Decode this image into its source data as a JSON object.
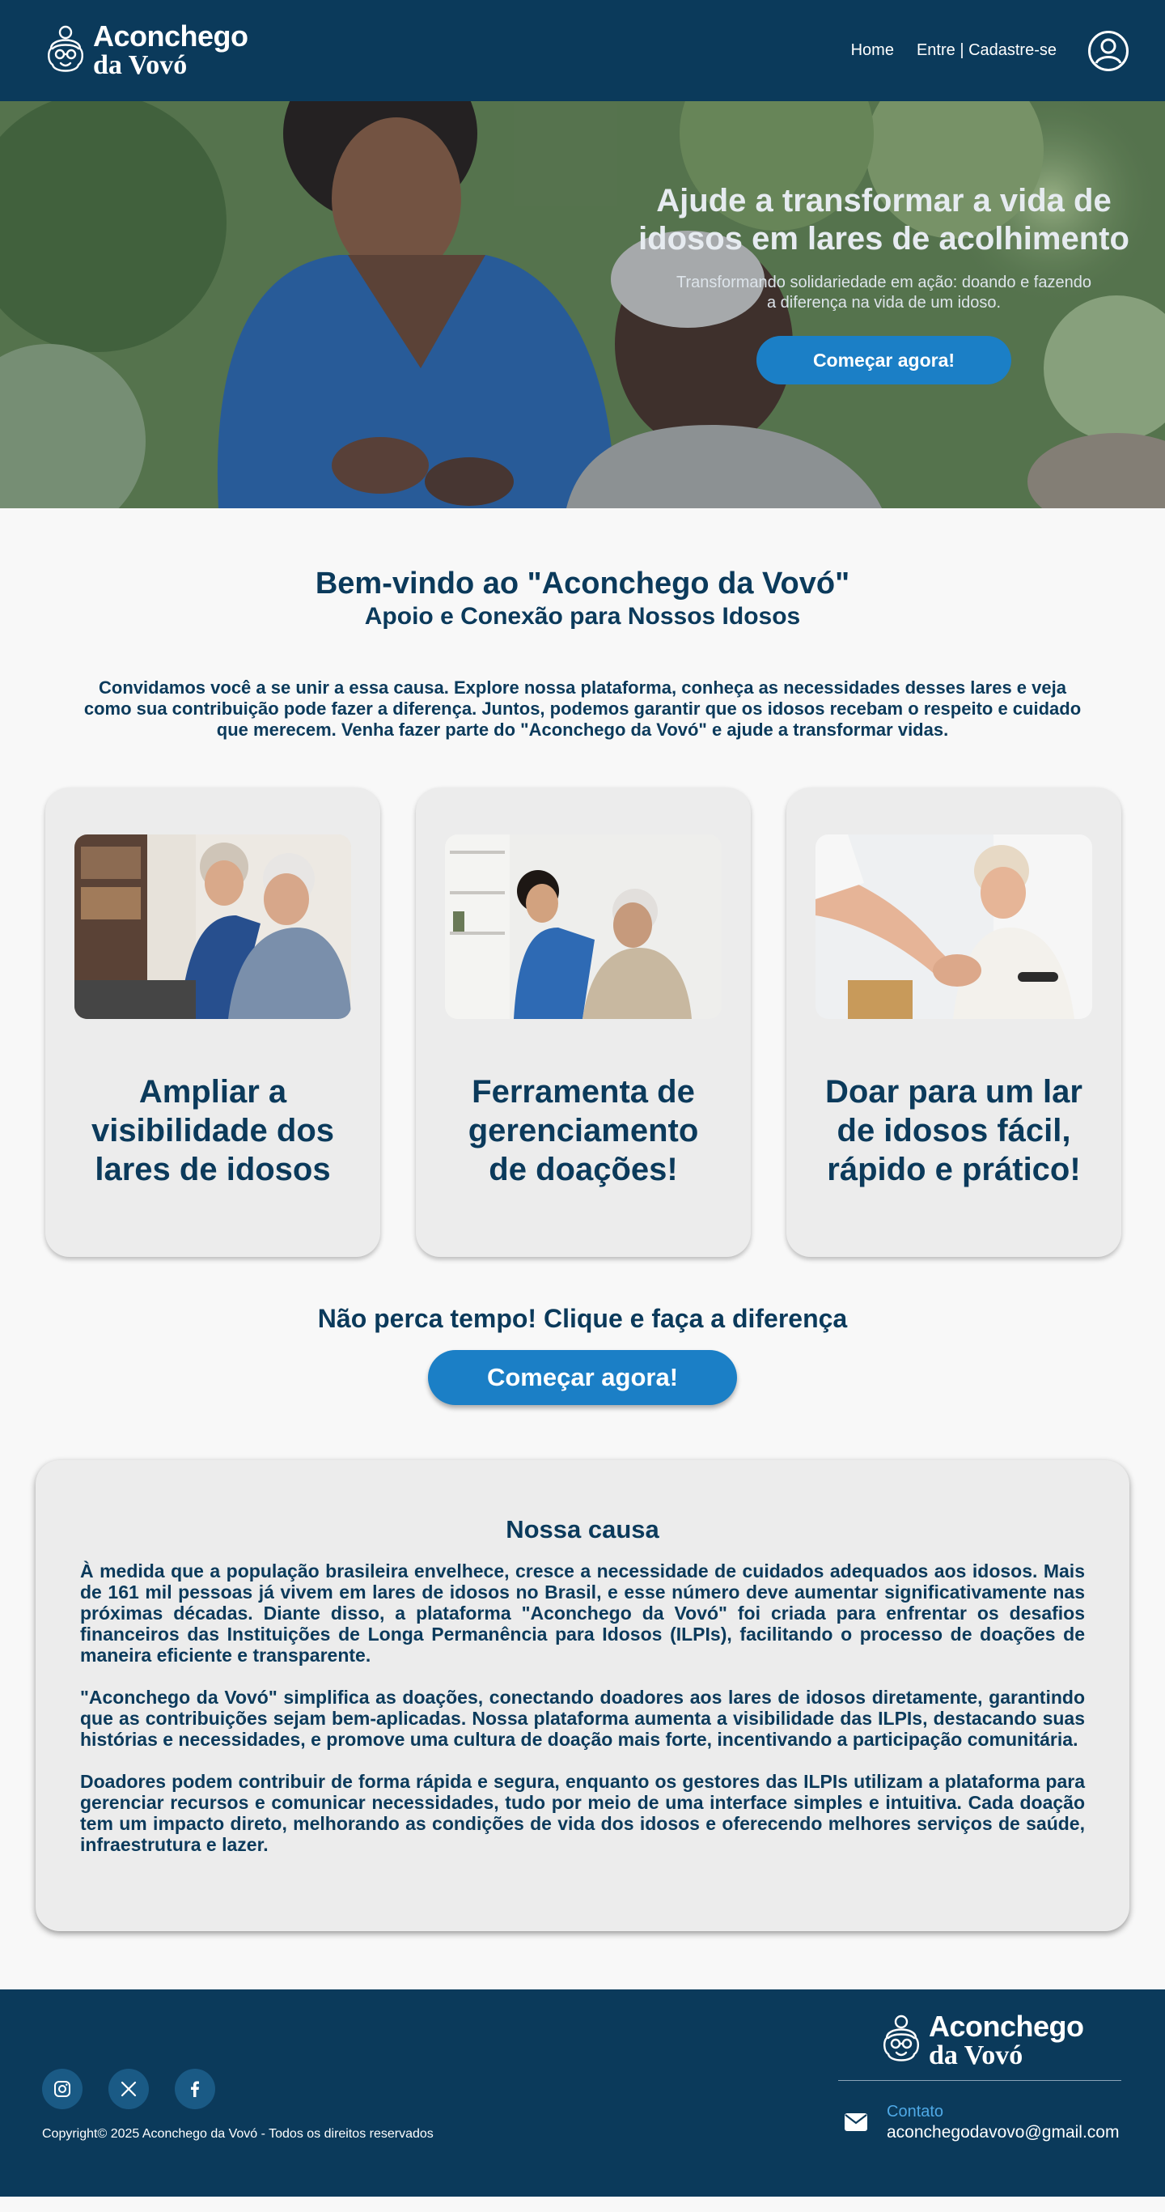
{
  "brand": {
    "line1": "Aconchego",
    "line2": "da Vovó",
    "logo_icon": "grandma-face-icon"
  },
  "nav": {
    "home": "Home",
    "login": "Entre | Cadastre-se",
    "profile_icon": "user-circle-icon"
  },
  "hero": {
    "title": "Ajude a transformar a vida de idosos em lares de acolhimento",
    "subtitle": "Transformando solidariedade em ação: doando e fazendo a diferença na vida de um idoso.",
    "button": "Começar agora!"
  },
  "welcome": {
    "title": "Bem-vindo ao \"Aconchego da Vovó\"",
    "subtitle": "Apoio e Conexão para Nossos Idosos",
    "intro": "Convidamos você a se unir a essa causa. Explore nossa plataforma, conheça as necessidades desses lares e veja como sua contribuição pode fazer a diferença. Juntos, podemos garantir que os idosos recebam o respeito e cuidado que merecem. Venha fazer parte do \"Aconchego da Vovó\" e ajude a transformar vidas."
  },
  "cards": [
    {
      "title": "Ampliar a visibilidade dos lares de idosos"
    },
    {
      "title": "Ferramenta de gerenciamento de doações!"
    },
    {
      "title": "Doar para um lar de idosos fácil, rápido e prático!"
    }
  ],
  "cta": {
    "title": "Não perca tempo! Clique e faça a diferença",
    "button": "Começar agora!"
  },
  "cause": {
    "title": "Nossa causa",
    "paragraphs": [
      "À medida que a população brasileira envelhece, cresce a necessidade de cuidados adequados aos idosos. Mais de 161 mil pessoas já vivem em lares de idosos no Brasil, e esse número deve aumentar significativamente nas próximas décadas. Diante disso, a plataforma \"Aconchego da Vovó\" foi criada para enfrentar os desafios financeiros das Instituições de Longa Permanência para Idosos (ILPIs), facilitando o processo de doações de maneira eficiente e transparente.",
      "\"Aconchego da Vovó\" simplifica as doações, conectando doadores aos lares de idosos diretamente, garantindo que as contribuições sejam bem-aplicadas. Nossa plataforma aumenta a visibilidade das ILPIs, destacando suas histórias e necessidades, e promove uma cultura de doação mais forte, incentivando a participação comunitária.",
      "Doadores podem contribuir de forma rápida e segura, enquanto os gestores das ILPIs utilizam a plataforma para gerenciar recursos e comunicar necessidades, tudo por meio de uma interface simples e intuitiva. Cada doação tem um impacto direto, melhorando as condições de vida dos idosos e oferecendo melhores serviços de saúde, infraestrutura e lazer."
    ]
  },
  "footer": {
    "socials": [
      "instagram-icon",
      "x-icon",
      "facebook-icon"
    ],
    "copyright": "Copyright© 2025 Aconchego da Vovó - Todos os direitos reservados",
    "contact_label": "Contato",
    "contact_email": "aconchegodavovo@gmail.com",
    "contact_icon": "mail-icon"
  },
  "colors": {
    "navy": "#0b3a5b",
    "accent_blue": "#1b7fc6",
    "card_bg": "#ececec",
    "page_bg": "#f8f8f8"
  }
}
